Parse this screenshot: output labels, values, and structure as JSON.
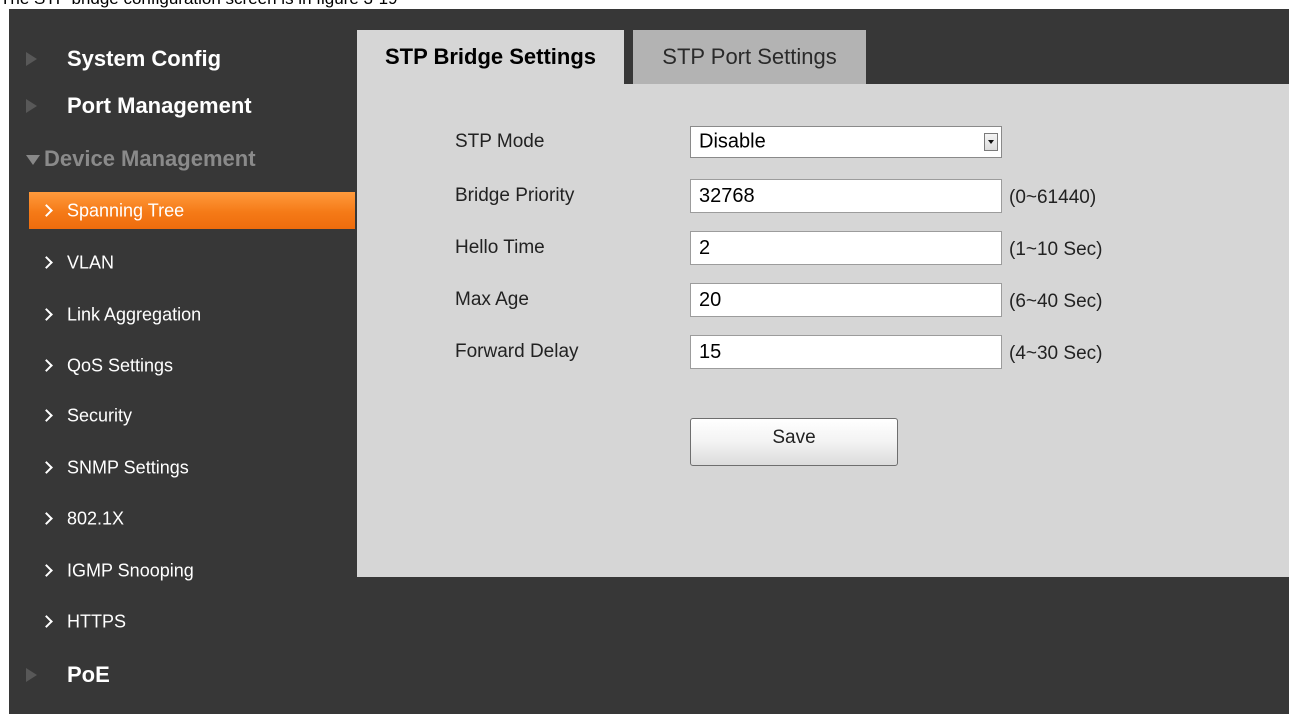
{
  "caption": "The STP bridge configuration screen is in figure 3-19",
  "sidebar": {
    "system_config": "System Config",
    "port_management": "Port Management",
    "device_management": "Device Management",
    "poe": "PoE",
    "sub_items": [
      {
        "label": "Spanning Tree",
        "active": true
      },
      {
        "label": "VLAN",
        "active": false
      },
      {
        "label": "Link Aggregation",
        "active": false
      },
      {
        "label": "QoS Settings",
        "active": false
      },
      {
        "label": "Security",
        "active": false
      },
      {
        "label": "SNMP Settings",
        "active": false
      },
      {
        "label": "802.1X",
        "active": false
      },
      {
        "label": "IGMP Snooping",
        "active": false
      },
      {
        "label": "HTTPS",
        "active": false
      }
    ]
  },
  "tabs": {
    "bridge": "STP Bridge Settings",
    "port": "STP Port Settings"
  },
  "form": {
    "stp_mode": {
      "label": "STP Mode",
      "value": "Disable"
    },
    "bridge_priority": {
      "label": "Bridge Priority",
      "value": "32768",
      "range": "(0~61440)"
    },
    "hello_time": {
      "label": "Hello Time",
      "value": "2",
      "range": "(1~10 Sec)"
    },
    "max_age": {
      "label": "Max Age",
      "value": "20",
      "range": "(6~40 Sec)"
    },
    "forward_delay": {
      "label": "Forward Delay",
      "value": "15",
      "range": "(4~30 Sec)"
    },
    "save_label": "Save"
  },
  "colors": {
    "background": "#373737",
    "accent": "#f57a17",
    "panel": "#d6d6d6"
  },
  "icons": {
    "collapsed": "triangle-right-icon",
    "expanded": "triangle-down-icon",
    "sub_item": "chevron-right-icon",
    "select": "dropdown-arrow-icon"
  }
}
